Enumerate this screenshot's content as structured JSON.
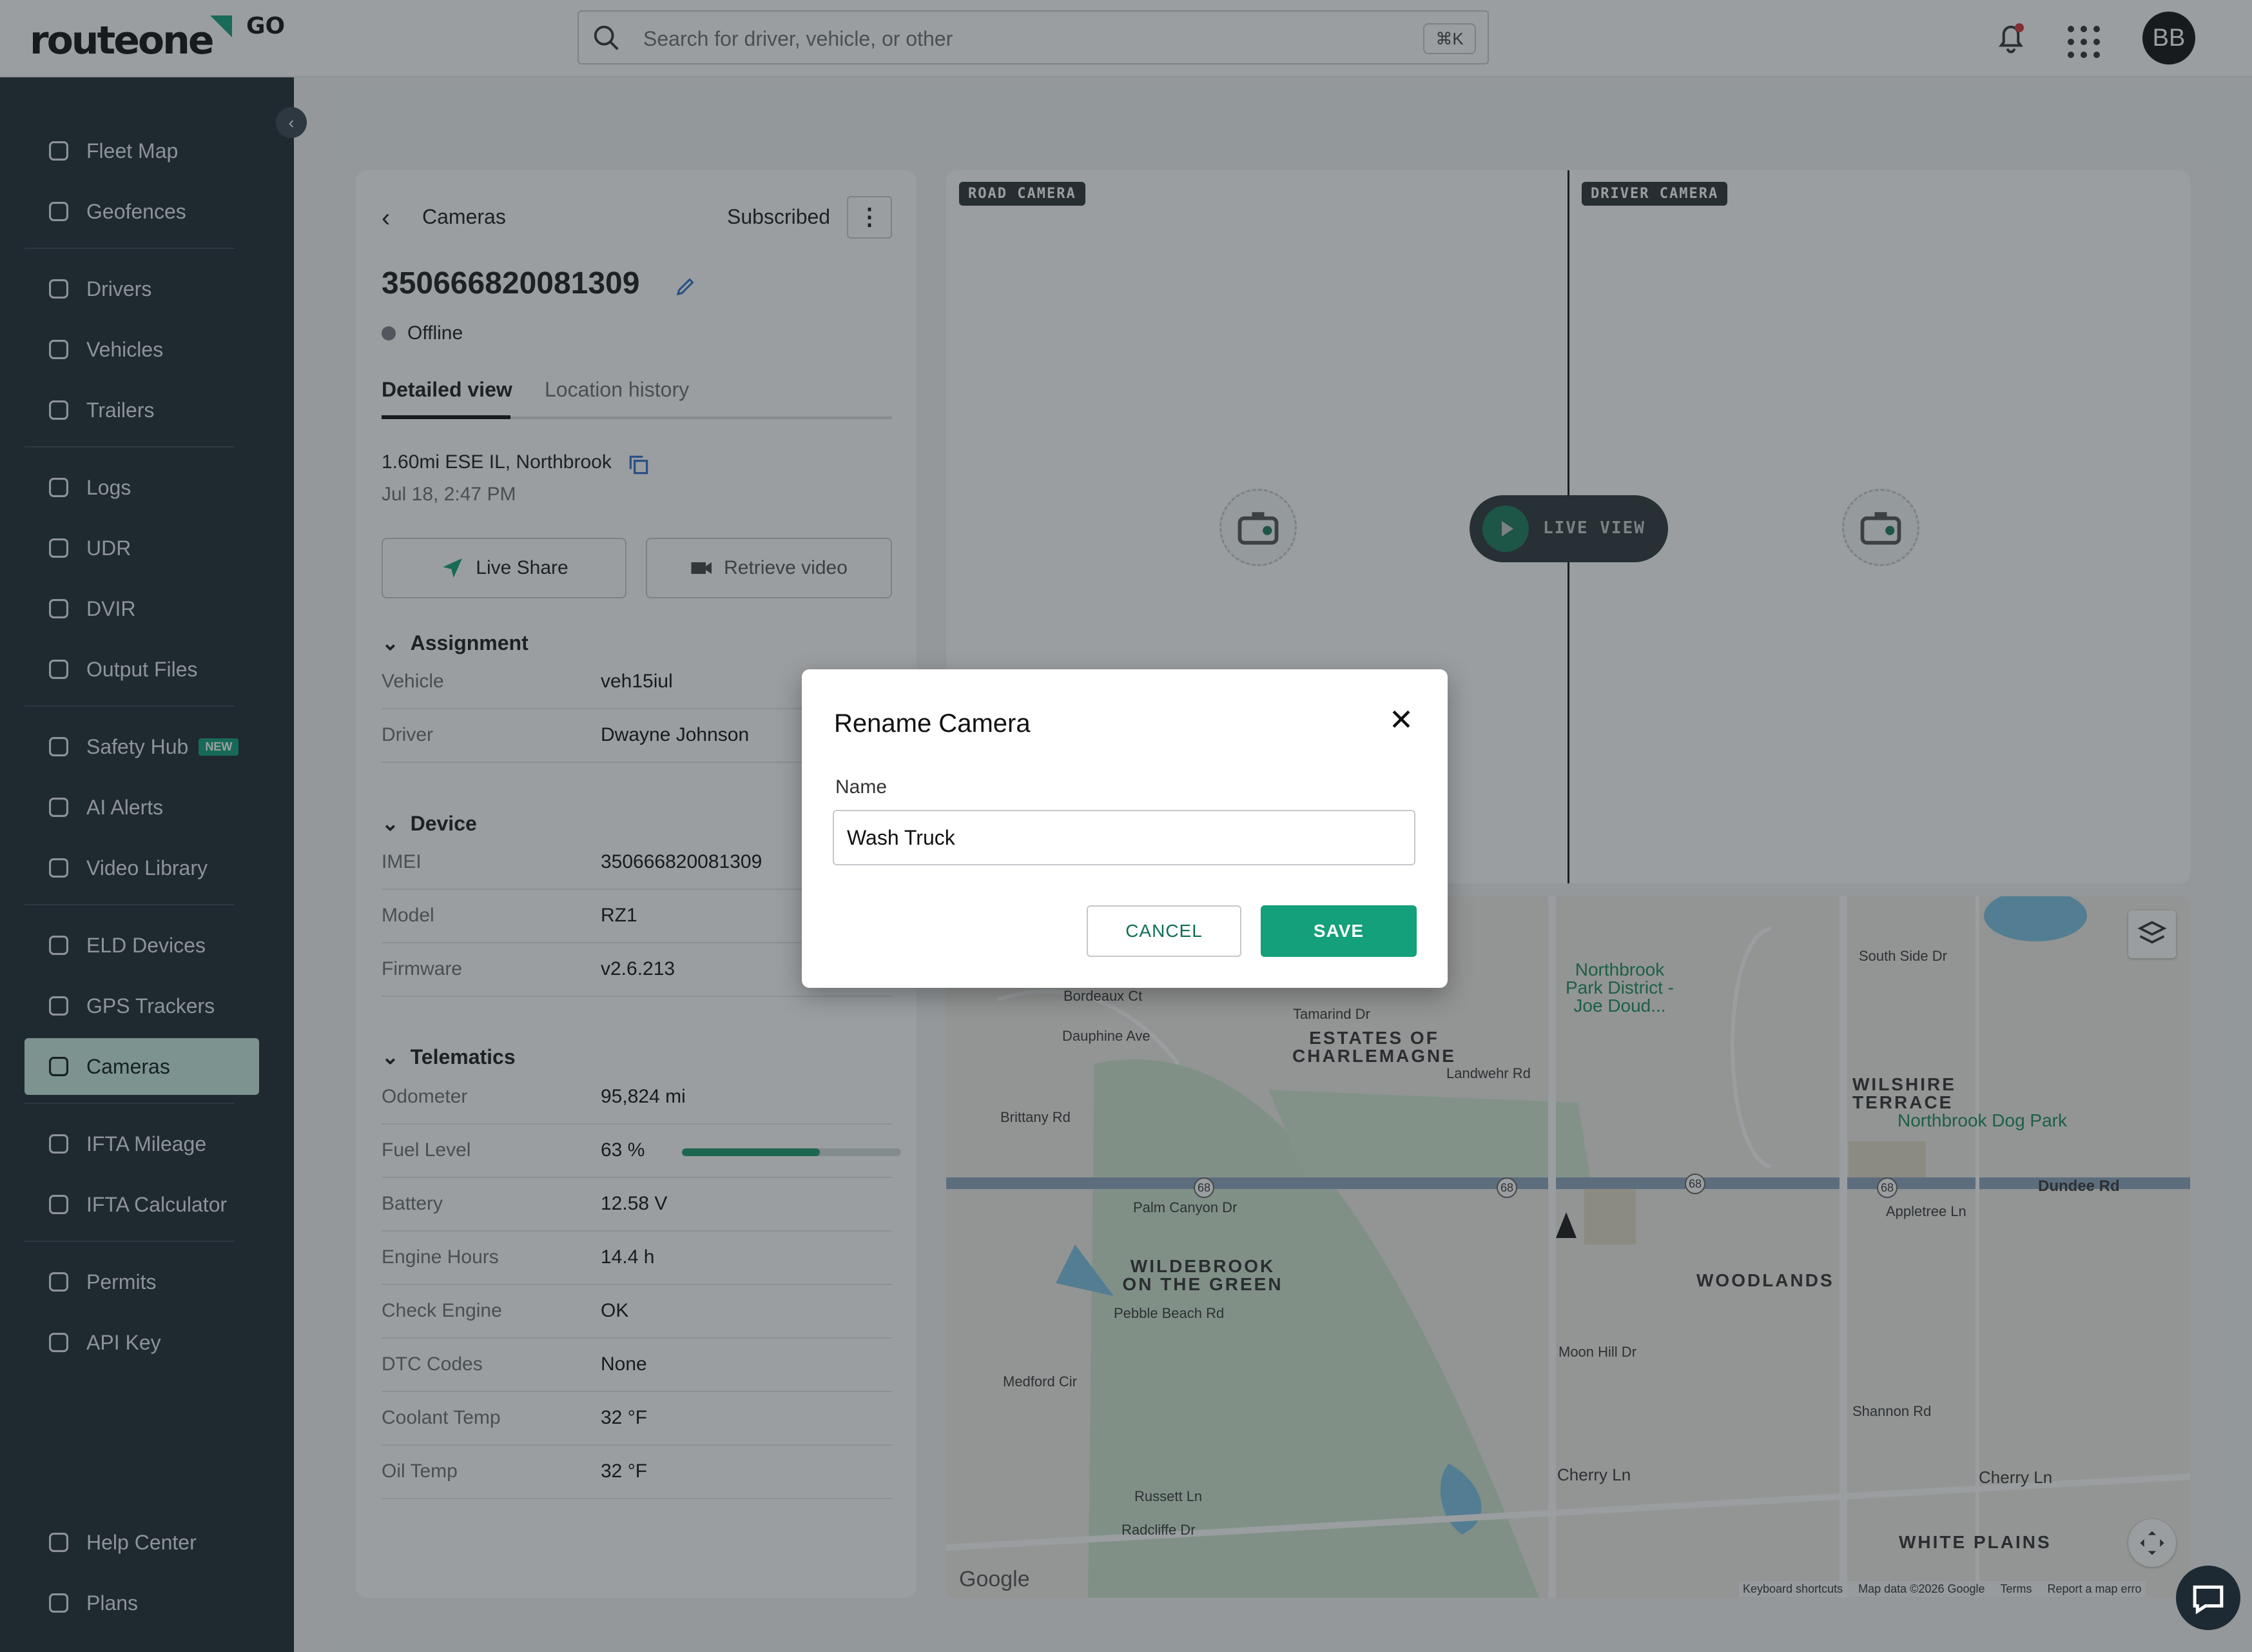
{
  "app": {
    "logo_text": "routeone",
    "logo_suffix": "GO",
    "avatar_initials": "BB",
    "brand_color": "#14a07a"
  },
  "search": {
    "placeholder": "Search for driver, vehicle, or other",
    "shortcut": "⌘K"
  },
  "sidebar": {
    "items": [
      {
        "label": "Fleet Map",
        "icon": "map-pin-icon"
      },
      {
        "label": "Geofences",
        "icon": "geofence-icon"
      },
      {
        "label": "Drivers",
        "icon": "steering-wheel-icon"
      },
      {
        "label": "Vehicles",
        "icon": "vehicle-icon"
      },
      {
        "label": "Trailers",
        "icon": "trailer-icon"
      },
      {
        "label": "Logs",
        "icon": "logs-icon"
      },
      {
        "label": "UDR",
        "icon": "udr-icon"
      },
      {
        "label": "DVIR",
        "icon": "clipboard-check-icon"
      },
      {
        "label": "Output Files",
        "icon": "grid-icon"
      },
      {
        "label": "Safety Hub",
        "icon": "shield-icon",
        "badge": "NEW"
      },
      {
        "label": "AI Alerts",
        "icon": "ai-alert-icon"
      },
      {
        "label": "Video Library",
        "icon": "video-icon"
      },
      {
        "label": "ELD Devices",
        "icon": "eld-device-icon"
      },
      {
        "label": "GPS Trackers",
        "icon": "gps-tracker-icon"
      },
      {
        "label": "Cameras",
        "icon": "camera-icon",
        "active": true
      },
      {
        "label": "IFTA Mileage",
        "icon": "route-icon"
      },
      {
        "label": "IFTA Calculator",
        "icon": "calculator-icon"
      },
      {
        "label": "Permits",
        "icon": "permit-icon"
      },
      {
        "label": "API Key",
        "icon": "key-icon"
      },
      {
        "label": "Help Center",
        "icon": "help-icon"
      },
      {
        "label": "Plans",
        "icon": "tag-icon"
      }
    ]
  },
  "panel": {
    "back_label": "Cameras",
    "subscription": "Subscribed",
    "device_id": "350666820081309",
    "status": "Offline",
    "tabs": [
      "Detailed view",
      "Location history"
    ],
    "location": "1.60mi ESE IL, Northbrook",
    "timestamp": "Jul 18, 2:47 PM",
    "live_share": "Live Share",
    "retrieve_video": "Retrieve video",
    "assignment": {
      "title": "Assignment",
      "rows": [
        {
          "k": "Vehicle",
          "v": "veh15iul"
        },
        {
          "k": "Driver",
          "v": "Dwayne Johnson"
        }
      ]
    },
    "device": {
      "title": "Device",
      "rows": [
        {
          "k": "IMEI",
          "v": "350666820081309"
        },
        {
          "k": "Model",
          "v": "RZ1"
        },
        {
          "k": "Firmware",
          "v": "v2.6.213"
        }
      ]
    },
    "telematics": {
      "title": "Telematics",
      "fuel_fraction": 0.63,
      "rows": [
        {
          "k": "Odometer",
          "v": "95,824 mi"
        },
        {
          "k": "Fuel Level",
          "v": "63 %"
        },
        {
          "k": "Battery",
          "v": "12.58 V"
        },
        {
          "k": "Engine Hours",
          "v": "14.4 h"
        },
        {
          "k": "Check Engine",
          "v": "OK"
        },
        {
          "k": "DTC Codes",
          "v": "None"
        },
        {
          "k": "Coolant Temp",
          "v": "32 °F"
        },
        {
          "k": "Oil Temp",
          "v": "32 °F"
        }
      ]
    }
  },
  "cameras": {
    "road_label": "ROAD CAMERA",
    "driver_label": "DRIVER CAMERA",
    "live_view": "LIVE VIEW"
  },
  "map": {
    "labels": {
      "northbrook_park": "Northbrook Park District - Joe Doud...",
      "estates": "ESTATES OF CHARLEMAGNE",
      "wilshire": "WILSHIRE TERRACE",
      "dog_park": "Northbrook Dog Park",
      "wildebrook": "WILDEBROOK ON THE GREEN",
      "woodlands": "WOODLANDS",
      "white_plains": "WHITE PLAINS",
      "dundee": "Dundee Rd",
      "south_side": "South Side Dr",
      "bordeaux": "Bordeaux Ct",
      "dauphine": "Dauphine Ave",
      "tamarind": "Tamarind Dr",
      "landwehr": "Landwehr Rd",
      "brittany": "Brittany Rd",
      "palm_canyon": "Palm Canyon Dr",
      "appletree": "Appletree Ln",
      "pebble_beach": "Pebble Beach Rd",
      "moon_hill": "Moon Hill Dr",
      "medford": "Medford Cir",
      "shannon": "Shannon Rd",
      "cherry_left": "Cherry Ln",
      "cherry_right": "Cherry Ln",
      "russett": "Russett Ln",
      "radcliffe": "Radcliffe Dr",
      "route": "68",
      "google": "Google",
      "shortcuts": "Keyboard shortcuts",
      "map_data": "Map data ©2026 Google",
      "terms": "Terms",
      "report": "Report a map erro"
    }
  },
  "modal": {
    "title": "Rename Camera",
    "name_label": "Name",
    "name_value": "Wash Truck",
    "cancel": "CANCEL",
    "save": "SAVE"
  }
}
